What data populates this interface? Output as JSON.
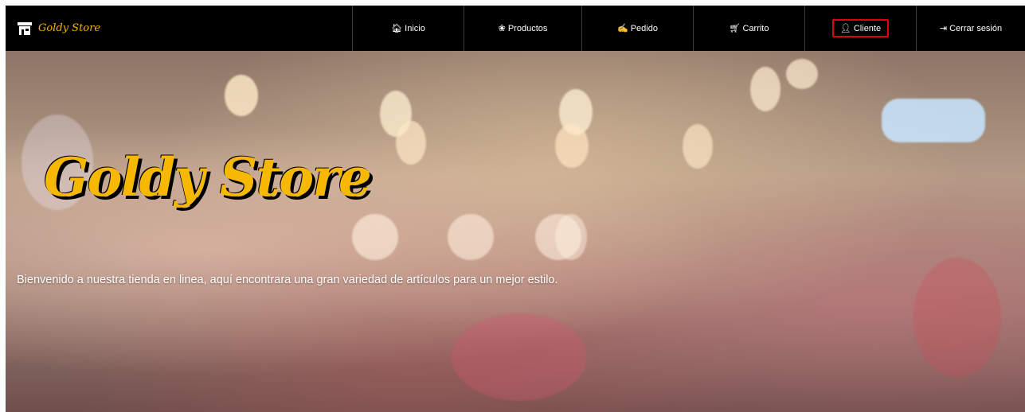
{
  "brand": {
    "name": "Goldy Store",
    "icon": "store-icon",
    "color": "#f4b400"
  },
  "nav": {
    "items": [
      {
        "label": "Inicio",
        "icon": "home-icon"
      },
      {
        "label": "Productos",
        "icon": "products-icon"
      },
      {
        "label": "Pedido",
        "icon": "order-icon"
      },
      {
        "label": "Carrito",
        "icon": "cart-icon"
      },
      {
        "label": "Cliente",
        "icon": "user-icon",
        "highlighted": true,
        "highlight_color": "#e0000f"
      },
      {
        "label": "Cerrar sesión",
        "icon": "logout-icon"
      }
    ]
  },
  "hero": {
    "title": "Goldy Store",
    "text": "Bienvenido a nuestra tienda en linea, aquí encontrara una gran variedad de artículos para un mejor estilo."
  }
}
